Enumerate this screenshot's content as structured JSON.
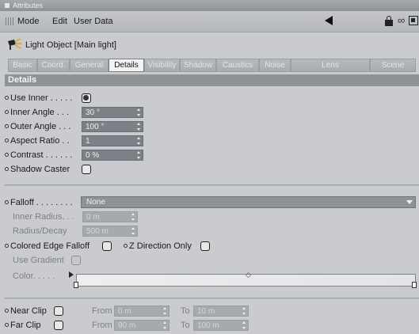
{
  "window": {
    "title": "Attributes"
  },
  "menu": {
    "mode": "Mode",
    "edit": "Edit",
    "user_data": "User Data"
  },
  "object": {
    "title": "Light Object [Main light]"
  },
  "tabs": [
    {
      "label": "Basic"
    },
    {
      "label": "Coord."
    },
    {
      "label": "General"
    },
    {
      "label": "Details"
    },
    {
      "label": "Visibility"
    },
    {
      "label": "Shadow"
    },
    {
      "label": "Caustics"
    },
    {
      "label": "Noise"
    },
    {
      "label": "Lens"
    },
    {
      "label": "Scene"
    }
  ],
  "section": {
    "title": "Details"
  },
  "details": {
    "use_inner": {
      "label": "Use Inner . . . . .",
      "checked": true
    },
    "inner_angle": {
      "label": "Inner Angle . . .",
      "value": "30 °"
    },
    "outer_angle": {
      "label": "Outer Angle . . .",
      "value": "100 °"
    },
    "aspect_ratio": {
      "label": "Aspect Ratio . .",
      "value": "1"
    },
    "contrast": {
      "label": "Contrast . . . . . .",
      "value": "0 %"
    },
    "shadow_caster": {
      "label": "Shadow Caster",
      "checked": false
    }
  },
  "falloff": {
    "label": "Falloff . . . . . . . .",
    "value": "None",
    "inner_radius": {
      "label": "Inner Radius. . .",
      "value": "0 m"
    },
    "radius_decay": {
      "label": "Radius/Decay",
      "value": "500 m"
    },
    "colored_edge": {
      "label": "Colored Edge Falloff",
      "checked": false
    },
    "z_direction": {
      "label": "Z Direction Only",
      "checked": false
    },
    "use_gradient": {
      "label": "Use Gradient",
      "checked": false
    },
    "color": {
      "label": "Color. . . . ."
    }
  },
  "clip": {
    "near": {
      "label": "Near Clip",
      "from_label": "From",
      "from_value": "0 m",
      "to_label": "To",
      "to_value": "10 m"
    },
    "far": {
      "label": "Far Clip",
      "from_label": "From",
      "from_value": "90 m",
      "to_label": "To",
      "to_value": "100 m"
    }
  }
}
